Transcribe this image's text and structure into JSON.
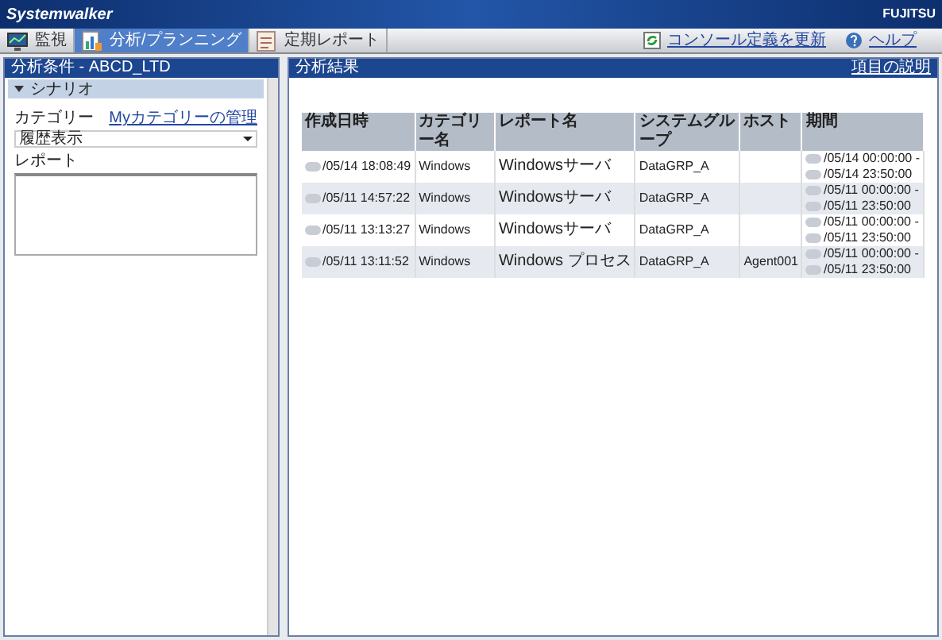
{
  "header": {
    "product": "Systemwalker",
    "vendor": "FUJITSU"
  },
  "tabs": [
    {
      "label": "監視",
      "selected": false
    },
    {
      "label": "分析/プランニング",
      "selected": true
    },
    {
      "label": "定期レポート",
      "selected": false
    }
  ],
  "toolbar_links": [
    {
      "label": "コンソール定義を更新",
      "kind": "refresh"
    },
    {
      "label": "ヘルプ",
      "kind": "help"
    }
  ],
  "left_panel": {
    "title": "分析条件 - ABCD_LTD",
    "section": {
      "label": "シナリオ",
      "expanded": true
    },
    "category_label": "カテゴリー",
    "category_link": "Myカテゴリーの管理",
    "category_value": "履歴表示",
    "report_label": "レポート"
  },
  "right_panel": {
    "title": "分析結果",
    "link": "項目の説明",
    "table": {
      "columns": [
        "作成日時",
        "カテゴリー名",
        "レポート名",
        "システムグループ",
        "ホスト",
        "期間"
      ],
      "rows": [
        [
          "/05/14 18:08:49",
          "Windows",
          "Windowsサーバ",
          "DataGRP_A",
          "",
          "/05/14 00:00:00 - /05/14 23:50:00"
        ],
        [
          "/05/11 14:57:22",
          "Windows",
          "Windowsサーバ",
          "DataGRP_A",
          "",
          "/05/11 00:00:00 - /05/11 23:50:00"
        ],
        [
          "/05/11 13:13:27",
          "Windows",
          "Windowsサーバ",
          "DataGRP_A",
          "",
          "/05/11 00:00:00 - /05/11 23:50:00"
        ],
        [
          "/05/11 13:11:52",
          "Windows",
          "Windows プロセス",
          "DataGRP_A",
          "Agent001",
          "/05/11 00:00:00 - /05/11 23:50:00"
        ]
      ]
    }
  }
}
